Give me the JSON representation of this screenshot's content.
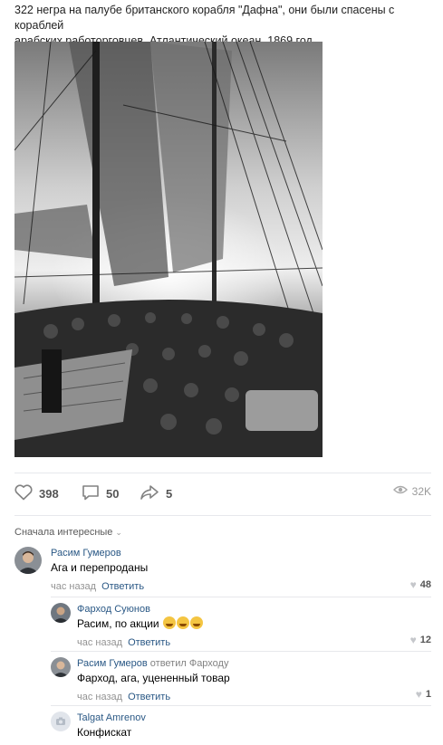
{
  "post": {
    "text_line1": "322 негра на палубе британского корабля \"Дафна\", они были спасены с кораблей",
    "text_line2": "арабских работорговцев, Атлантический океан, 1869 год."
  },
  "actions": {
    "likes": "398",
    "comments": "50",
    "shares": "5",
    "views": "32K"
  },
  "comments_section": {
    "sort_label": "Сначала интересные"
  },
  "comments": [
    {
      "author": "Расим Гумеров",
      "reply_to": "",
      "text": "Ага и перепроданы",
      "time": "час назад",
      "reply_label": "Ответить",
      "likes": "48"
    },
    {
      "author": "Фарход Суюнов",
      "reply_to": "",
      "text": "Расим, по акции",
      "time": "час назад",
      "reply_label": "Ответить",
      "likes": "12"
    },
    {
      "author": "Расим Гумеров",
      "reply_to": "ответил Фарходу",
      "text": "Фарход, ага, уцененный товар",
      "time": "час назад",
      "reply_label": "Ответить",
      "likes": "1"
    },
    {
      "author": "Talgat Amrenov",
      "reply_to": "",
      "text": "Конфискат",
      "time": "",
      "reply_label": "",
      "likes": ""
    }
  ]
}
